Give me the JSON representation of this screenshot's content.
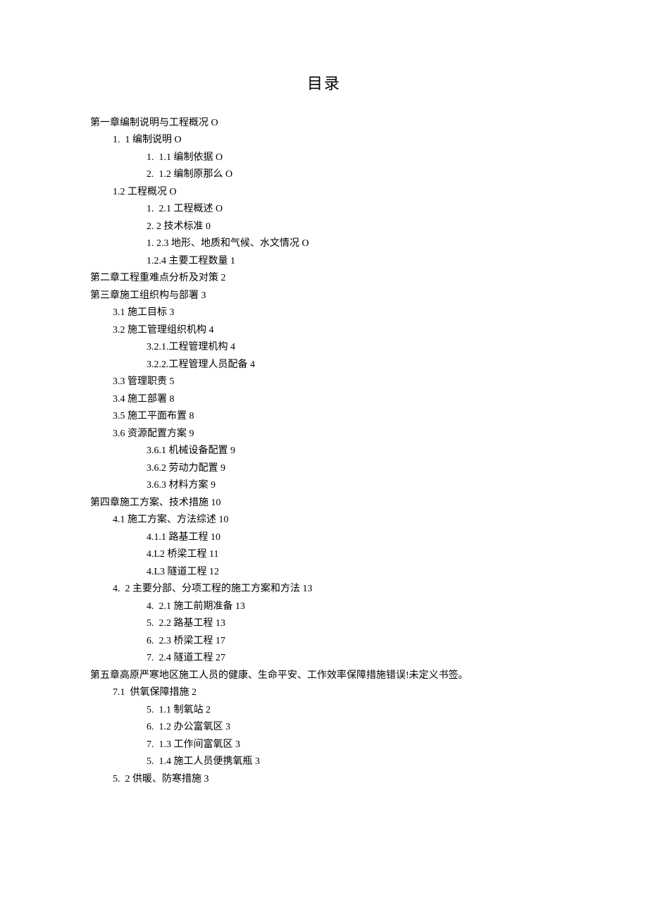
{
  "title": "目录",
  "entries": [
    {
      "level": 0,
      "text": "第一章编制说明与工程概况 O"
    },
    {
      "level": 1,
      "text": "1.  1 编制说明 O"
    },
    {
      "level": 2,
      "text": "1.  1.1 编制依据 O"
    },
    {
      "level": 2,
      "text": "2.  1.2 编制原那么 O"
    },
    {
      "level": 1,
      "text": "1.2 工程概况 O"
    },
    {
      "level": 2,
      "text": "1.  2.1 工程概述 O"
    },
    {
      "level": 2,
      "text": "2. 2 技术标准 0"
    },
    {
      "level": 2,
      "text": "1. 2.3 地形、地质和气候、水文情况 O"
    },
    {
      "level": 2,
      "text": "1.2.4 主要工程数量 1"
    },
    {
      "level": 0,
      "text": "第二章工程重难点分析及对策 2"
    },
    {
      "level": 0,
      "text": "第三章施工组织构与部署 3"
    },
    {
      "level": 1,
      "text": "3.1 施工目标 3"
    },
    {
      "level": 1,
      "text": "3.2 施工管理组织机构 4"
    },
    {
      "level": 2,
      "text": "3.2.1.工程管理机构 4"
    },
    {
      "level": 2,
      "text": "3.2.2.工程管理人员配备 4"
    },
    {
      "level": 1,
      "text": "3.3 管理职责 5"
    },
    {
      "level": 1,
      "text": "3.4 施工部署 8"
    },
    {
      "level": 1,
      "text": "3.5 施工平面布置 8"
    },
    {
      "level": 1,
      "text": "3.6 资源配置方案 9"
    },
    {
      "level": 2,
      "text": "3.6.1 机械设备配置 9"
    },
    {
      "level": 2,
      "text": "3.6.2 劳动力配置 9"
    },
    {
      "level": 2,
      "text": "3.6.3 材料方案 9"
    },
    {
      "level": 0,
      "text": "第四章施工方案、技术措施 10"
    },
    {
      "level": 1,
      "text": "4.1 施工方案、方法综述 10"
    },
    {
      "level": 2,
      "text": "4.1.1 路基工程 10"
    },
    {
      "level": 2,
      "text": "4.L2 桥梁工程 11"
    },
    {
      "level": 2,
      "text": "4.L3 隧道工程 12"
    },
    {
      "level": 1,
      "text": "4.  2 主要分部、分项工程的施工方案和方法 13"
    },
    {
      "level": 2,
      "text": "4.  2.1 施工前期准备 13"
    },
    {
      "level": 2,
      "text": "5.  2.2 路基工程 13"
    },
    {
      "level": 2,
      "text": "6.  2.3 桥梁工程 17"
    },
    {
      "level": 2,
      "text": "7.  2.4 隧道工程 27"
    },
    {
      "level": 0,
      "text": "第五章高原严寒地区施工人员的健康、生命平安、工作效率保障措施错误!未定义书签。"
    },
    {
      "level": 1,
      "text": "7.1  供氧保障措施 2"
    },
    {
      "level": 2,
      "text": "5.  1.1 制氧站 2"
    },
    {
      "level": 2,
      "text": "6.  1.2 办公富氧区 3"
    },
    {
      "level": 2,
      "text": "7.  1.3 工作间富氧区 3"
    },
    {
      "level": 2,
      "text": "5.  1.4 施工人员便携氧瓶 3"
    },
    {
      "level": 1,
      "text": "5.  2 供暖、防寒措施 3"
    }
  ]
}
